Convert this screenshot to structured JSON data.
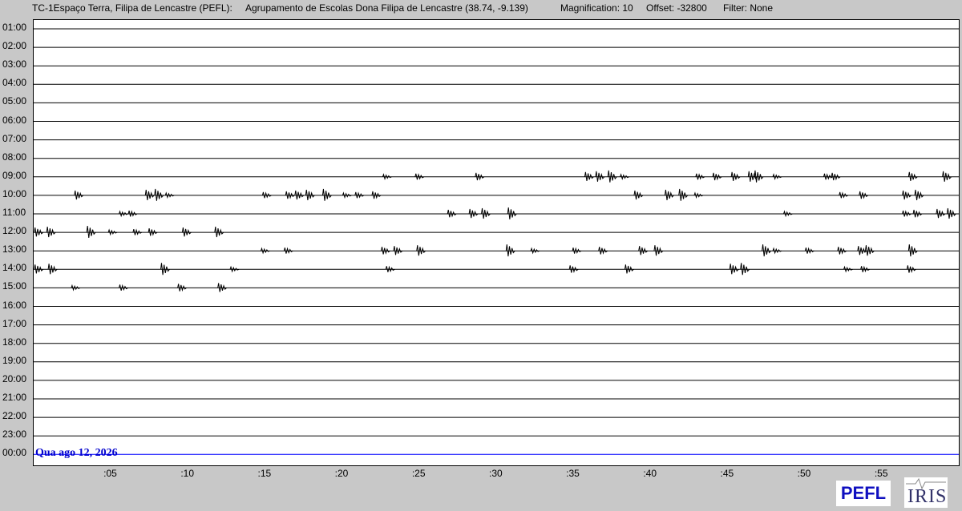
{
  "header": {
    "station": "TC-1Espaço Terra, Filipa de Lencastre (PEFL):",
    "location": "Agrupamento de Escolas Dona Filipa de Lencastre (38.74, -9.139)",
    "magnification": "Magnification: 10",
    "offset": "Offset: -32800",
    "filter": "Filter: None"
  },
  "hour_labels": [
    "01:00",
    "02:00",
    "03:00",
    "04:00",
    "05:00",
    "06:00",
    "07:00",
    "08:00",
    "09:00",
    "10:00",
    "11:00",
    "12:00",
    "13:00",
    "14:00",
    "15:00",
    "16:00",
    "17:00",
    "18:00",
    "19:00",
    "20:00",
    "21:00",
    "22:00",
    "23:00",
    "00:00"
  ],
  "minute_labels": [
    ":05",
    ":10",
    ":15",
    ":20",
    ":25",
    ":30",
    ":35",
    ":40",
    ":45",
    ":50",
    ":55"
  ],
  "date_label": "Qua ago 12, 2026",
  "logos": {
    "pefl": "PEFL",
    "iris": "IRIS"
  },
  "colors": {
    "trace": "#000000",
    "current_line": "#0000ff",
    "background": "#c8c8c8",
    "plot_background": "#ffffff"
  },
  "events": {
    "09:00": [
      22.9,
      25.0,
      28.9,
      36.0,
      36.7,
      37.5,
      38.3,
      43.2,
      44.3,
      45.5,
      46.6,
      47.0,
      48.2,
      51.5,
      52.0,
      57.0,
      59.2
    ],
    "10:00": [
      2.9,
      7.5,
      8.1,
      8.8,
      15.1,
      16.6,
      17.2,
      17.9,
      19.0,
      20.3,
      21.1,
      22.2,
      39.2,
      41.2,
      42.1,
      43.1,
      52.5,
      53.8,
      56.6,
      57.4
    ],
    "11:00": [
      5.8,
      6.4,
      27.1,
      28.5,
      29.3,
      31.0,
      48.9,
      56.6,
      57.3,
      58.8,
      59.5
    ],
    "12:00": [
      0.3,
      1.1,
      3.7,
      5.1,
      6.7,
      7.7,
      9.9,
      12.0
    ],
    "13:00": [
      15.0,
      16.5,
      22.8,
      23.6,
      25.1,
      30.9,
      32.5,
      35.2,
      36.9,
      39.5,
      40.5,
      47.5,
      48.2,
      50.3,
      52.4,
      53.7,
      54.2,
      57.0
    ],
    "14:00": [
      0.3,
      1.2,
      8.5,
      13.0,
      23.1,
      35.0,
      38.6,
      45.4,
      46.1,
      52.8,
      53.9,
      56.9
    ],
    "15:00": [
      2.7,
      5.8,
      9.6,
      12.2
    ]
  }
}
